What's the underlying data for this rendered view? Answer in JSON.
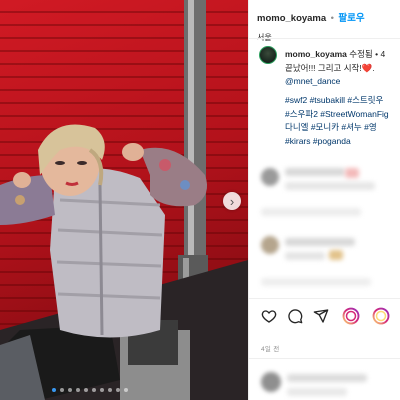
{
  "post": {
    "username": "momo_koyama",
    "separator": "•",
    "follow_label": "팔로우",
    "location": "서울"
  },
  "caption": {
    "username": "momo_koyama",
    "edited": "수정됨",
    "edited_sep": "•",
    "age_short": "4",
    "line1": "끝났어!!! 그리고 시작!",
    "heart": "❤️",
    "trailing": ".",
    "mention": "@mnet_dance",
    "hashtags": [
      "#swf2 #tsubakill #스트릿우",
      "#스우파2 #StreetWomanFig",
      "다니엘 #모니카 #셔누 #영",
      "#kirars #poganda"
    ]
  },
  "meta": {
    "time": "4일 전"
  },
  "carousel": {
    "next_icon": "chevron-right-icon",
    "slide_count": 10,
    "active_index": 0
  },
  "icons": {
    "like": "heart-icon",
    "comment": "comment-icon",
    "share": "send-icon",
    "story1": "story-ring-icon",
    "story2": "story-ring-icon"
  },
  "colors": {
    "link": "#00376b",
    "follow": "#0095f6",
    "wall_red": "#b3121b",
    "dot_active": "#3897f0"
  }
}
